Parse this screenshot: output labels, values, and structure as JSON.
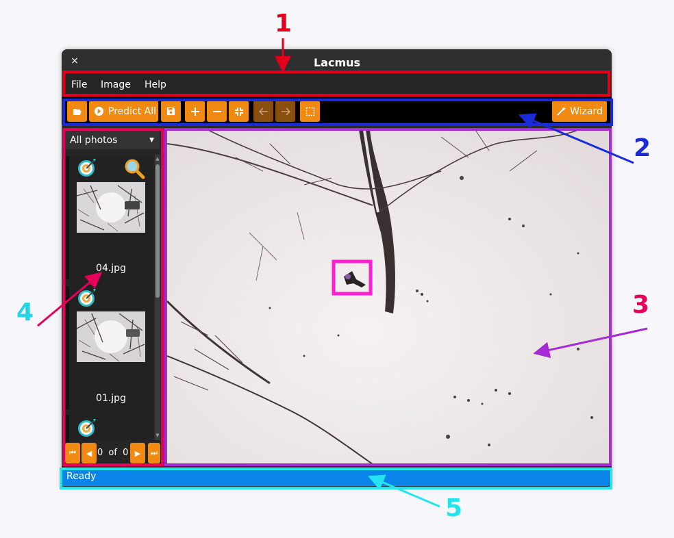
{
  "window": {
    "title": "Lacmus",
    "close_symbol": "×"
  },
  "menubar": {
    "items": [
      "File",
      "Image",
      "Help"
    ]
  },
  "toolbar": {
    "predict_all_label": "Predict All",
    "wizard_label": "Wizard",
    "icons": [
      "folder-open-icon",
      "predict-all-icon",
      "save-icon",
      "zoom-in-icon",
      "zoom-out-icon",
      "fit-screen-icon",
      "arrow-left-icon",
      "arrow-right-icon",
      "select-box-icon",
      "wand-icon"
    ]
  },
  "sidebar": {
    "filter_selected": "All photos",
    "photos": [
      {
        "name": "04.jpg",
        "has_detection": true,
        "searched": true
      },
      {
        "name": "01.jpg",
        "has_detection": true,
        "searched": false
      },
      {
        "name": "",
        "has_detection": true,
        "searched": false
      }
    ],
    "pager": {
      "current": "0",
      "of_label": "of",
      "total": "0"
    }
  },
  "statusbar": {
    "text": "Ready"
  },
  "annotations": [
    {
      "label": "1",
      "color": "#e4001b",
      "region": "menubar"
    },
    {
      "label": "2",
      "color": "#1a2bd8",
      "region": "toolbar"
    },
    {
      "label": "3",
      "color": "#e6005c",
      "region": "image-view"
    },
    {
      "label": "4",
      "color": "#26d4e8",
      "region": "photo-list"
    },
    {
      "label": "5",
      "color": "#22e5f0",
      "region": "statusbar"
    }
  ],
  "colors": {
    "accent_orange": "#f08a12",
    "status_blue": "#0a84e8",
    "detection_box": "#ff1fd0"
  }
}
